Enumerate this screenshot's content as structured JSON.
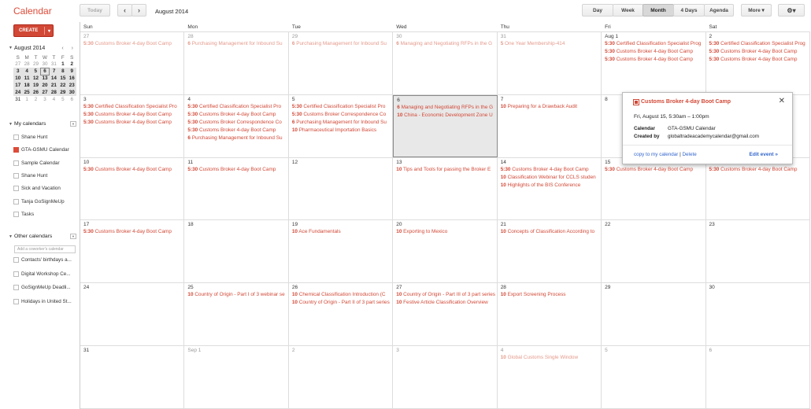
{
  "app": {
    "title": "Calendar"
  },
  "toolbar": {
    "today": "Today",
    "prev": "‹",
    "next": "›",
    "date_range": "August 2014",
    "views": [
      "Day",
      "Week",
      "Month",
      "4 Days",
      "Agenda"
    ],
    "active_view": "Month",
    "more": "More ▾",
    "settings": "⚙▾"
  },
  "create": {
    "label": "CREATE",
    "caret": "▾"
  },
  "mini_calendar": {
    "title": "August 2014",
    "arrows": "‹ ›",
    "dow": [
      "S",
      "M",
      "T",
      "W",
      "T",
      "F",
      "S"
    ],
    "weeks": [
      [
        "27",
        "28",
        "29",
        "30",
        "31",
        "1",
        "2"
      ],
      [
        "3",
        "4",
        "5",
        "6",
        "7",
        "8",
        "9"
      ],
      [
        "10",
        "11",
        "12",
        "13",
        "14",
        "15",
        "16"
      ],
      [
        "17",
        "18",
        "19",
        "20",
        "21",
        "22",
        "23"
      ],
      [
        "24",
        "25",
        "26",
        "27",
        "28",
        "29",
        "30"
      ],
      [
        "31",
        "1",
        "2",
        "3",
        "4",
        "5",
        "6"
      ]
    ]
  },
  "my_calendars": {
    "title": "My calendars",
    "items": [
      "Shane Hunt",
      "GTA-GSMU Calendar",
      "Sample Calendar",
      "Shane Hunt",
      "Sick and Vacation",
      "Tanja GoSignMeUp",
      "Tasks"
    ]
  },
  "other_calendars": {
    "title": "Other calendars",
    "placeholder": "Add a coworker's calendar",
    "items": [
      "Contacts' birthdays a...",
      "Digital Workshop Ce...",
      "GoSignMeUp Deadli...",
      "Holidays in United St..."
    ]
  },
  "grid": {
    "dow": [
      "Sun",
      "Mon",
      "Tue",
      "Wed",
      "Thu",
      "Fri",
      "Sat"
    ],
    "weeks": [
      [
        {
          "d": "27",
          "other": true,
          "ev": [
            [
              "5:30",
              "Customs Broker 4-day Boot Camp"
            ]
          ]
        },
        {
          "d": "28",
          "other": true,
          "ev": [
            [
              "6",
              "Purchasing Management for Inbound Su"
            ]
          ]
        },
        {
          "d": "29",
          "other": true,
          "ev": [
            [
              "6",
              "Purchasing Management for Inbound Su"
            ]
          ]
        },
        {
          "d": "30",
          "other": true,
          "ev": [
            [
              "6",
              "Managing and Negotiating RFPs in the G"
            ]
          ]
        },
        {
          "d": "31",
          "other": true,
          "ev": [
            [
              "5",
              "One Year Membership-414"
            ]
          ]
        },
        {
          "d": "Aug 1",
          "ev": [
            [
              "5:30",
              "Certified Classification Specialist Prog"
            ],
            [
              "5:30",
              "Customs Broker 4-day Boot Camp"
            ],
            [
              "5:30",
              "Customs Broker 4-day Boot Camp"
            ]
          ]
        },
        {
          "d": "2",
          "ev": [
            [
              "5:30",
              "Certified Classification Specialist Prog"
            ],
            [
              "5:30",
              "Customs Broker 4-day Boot Camp"
            ],
            [
              "5:30",
              "Customs Broker 4-day Boot Camp"
            ]
          ]
        }
      ],
      [
        {
          "d": "3",
          "ev": [
            [
              "5:30",
              "Certified Classification Specialist Pro"
            ],
            [
              "5:30",
              "Customs Broker 4-day Boot Camp"
            ],
            [
              "5:30",
              "Customs Broker 4-day Boot Camp"
            ]
          ]
        },
        {
          "d": "4",
          "ev": [
            [
              "5:30",
              "Certified Classification Specialist Pro"
            ],
            [
              "5:30",
              "Customs Broker 4-day Boot Camp"
            ],
            [
              "5:30",
              "Customs Broker Correspondence Co"
            ],
            [
              "5:30",
              "Customs Broker 4-day Boot Camp"
            ],
            [
              "6",
              "Purchasing Management for Inbound Su"
            ]
          ]
        },
        {
          "d": "5",
          "ev": [
            [
              "5:30",
              "Certified Classification Specialist Pro"
            ],
            [
              "5:30",
              "Customs Broker Correspondence Co"
            ],
            [
              "6",
              "Purchasing Management for Inbound Su"
            ],
            [
              "10",
              "Pharmaceutical Importation Basics"
            ]
          ]
        },
        {
          "d": "6",
          "sel": true,
          "ev": [
            [
              "6",
              "Managing and Negotiating RFPs in the G"
            ],
            [
              "10",
              "China - Economic Development Zone U"
            ]
          ]
        },
        {
          "d": "7",
          "ev": [
            [
              "10",
              "Preparing for a Drawback Audit"
            ]
          ]
        },
        {
          "d": "8",
          "ev": []
        },
        {
          "d": "9",
          "ev": []
        }
      ],
      [
        {
          "d": "10",
          "ev": [
            [
              "5:30",
              "Customs Broker 4-day Boot Camp"
            ]
          ]
        },
        {
          "d": "11",
          "ev": [
            [
              "5:30",
              "Customs Broker 4-day Boot Camp"
            ]
          ]
        },
        {
          "d": "12",
          "ev": []
        },
        {
          "d": "13",
          "ev": [
            [
              "10",
              "Tips and Tools for passing the Broker E"
            ]
          ]
        },
        {
          "d": "14",
          "ev": [
            [
              "5:30",
              "Customs Broker 4-day Boot Camp"
            ],
            [
              "10",
              "Classification Webinar for CCLS studen"
            ],
            [
              "10",
              "Highlights of the BIS Conference"
            ]
          ]
        },
        {
          "d": "15",
          "ev": [
            [
              "5:30",
              "Customs Broker 4-day Boot Camp"
            ]
          ]
        },
        {
          "d": "16",
          "ev": [
            [
              "5:30",
              "Customs Broker 4-day Boot Camp"
            ]
          ]
        }
      ],
      [
        {
          "d": "17",
          "ev": [
            [
              "5:30",
              "Customs Broker 4-day Boot Camp"
            ]
          ]
        },
        {
          "d": "18",
          "ev": []
        },
        {
          "d": "19",
          "ev": [
            [
              "10",
              "Ace Fundamentals"
            ]
          ]
        },
        {
          "d": "20",
          "ev": [
            [
              "10",
              "Exporting to Mexico"
            ]
          ]
        },
        {
          "d": "21",
          "ev": [
            [
              "10",
              "Concepts of Classification According to"
            ]
          ]
        },
        {
          "d": "22",
          "ev": []
        },
        {
          "d": "23",
          "ev": []
        }
      ],
      [
        {
          "d": "24",
          "ev": []
        },
        {
          "d": "25",
          "ev": [
            [
              "10",
              "Country of Origin - Part I of 3 webinar se"
            ]
          ]
        },
        {
          "d": "26",
          "ev": [
            [
              "10",
              "Chemical Classification Introduction (C"
            ],
            [
              "10",
              "Country of Origin - Part II of 3 part series"
            ]
          ]
        },
        {
          "d": "27",
          "ev": [
            [
              "10",
              "Country of Origin - Part III of 3 part series"
            ],
            [
              "10",
              "Festive Article Classification Overview"
            ]
          ]
        },
        {
          "d": "28",
          "ev": [
            [
              "10",
              "Export Screening Process"
            ]
          ]
        },
        {
          "d": "29",
          "ev": []
        },
        {
          "d": "30",
          "ev": []
        }
      ],
      [
        {
          "d": "31",
          "ev": []
        },
        {
          "d": "Sep 1",
          "other": true,
          "ev": []
        },
        {
          "d": "2",
          "other": true,
          "ev": []
        },
        {
          "d": "3",
          "other": true,
          "ev": []
        },
        {
          "d": "4",
          "other": true,
          "ev": [
            [
              "10",
              "Global Customs Single Window"
            ]
          ]
        },
        {
          "d": "5",
          "other": true,
          "ev": []
        },
        {
          "d": "6",
          "other": true,
          "ev": []
        }
      ]
    ]
  },
  "popup": {
    "title": "Customs Broker 4-day Boot Camp",
    "close": "✕",
    "when": "Fri, August 15, 5:30am – 1:00pm",
    "calendar_label": "Calendar",
    "calendar_value": "GTA-GSMU Calendar",
    "created_label": "Created by",
    "created_value": "globaltradeacademycalendar@gmail.com",
    "copy": "copy to my calendar",
    "pipe": "|",
    "delete": "Delete",
    "edit": "Edit event »"
  },
  "colors": {
    "accent": "#d14836",
    "brand": "#dd4b39",
    "link": "#3366cc"
  }
}
